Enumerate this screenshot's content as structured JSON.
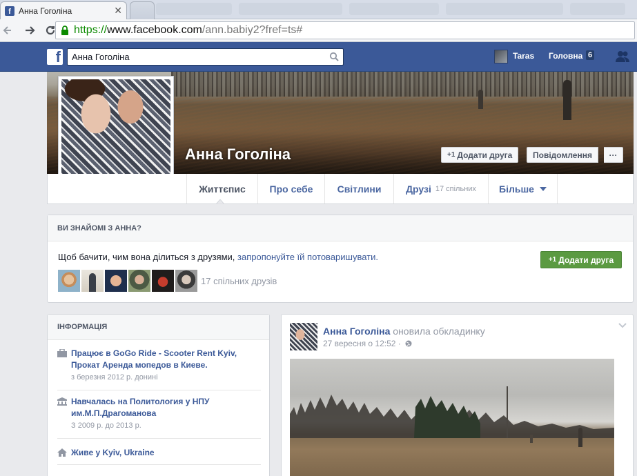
{
  "browser": {
    "active_tab_title": "Анна Гоголіна",
    "url_protocol": "https://",
    "url_host": "www.facebook.com",
    "url_path": "/ann.babiy2?fref=ts#"
  },
  "fb_header": {
    "search_value": "Анна Гоголіна",
    "user_name": "Taras",
    "home_label": "Головна",
    "home_count": "6"
  },
  "profile": {
    "name": "Анна Гоголіна",
    "add_friend_label": "Додати друга",
    "message_label": "Повідомлення",
    "more_label": "···",
    "plus_label": "+1"
  },
  "nav": {
    "items": [
      {
        "label": "Життєпис"
      },
      {
        "label": "Про себе"
      },
      {
        "label": "Світлини"
      },
      {
        "label": "Друзі",
        "count": "17 спільних"
      },
      {
        "label": "Більше"
      }
    ]
  },
  "know_box": {
    "header": "ВИ ЗНАЙОМІ З АННА?",
    "message_prefix": "Щоб бачити, чим вона ділиться з друзями, ",
    "message_link": "запропонуйте їй потоваришувати.",
    "add_friend_label": "Додати друга",
    "mutual_friends": "17 спільних друзів"
  },
  "info": {
    "header": "ІНФОРМАЦІЯ",
    "items": [
      {
        "title": "Працює в GoGo Ride - Scooter Rent Kyiv, Прокат Аренда мопедов в Киеве.",
        "sub": "з березня 2012 р. донині",
        "icon": "briefcase-icon"
      },
      {
        "title": "Навчалась на Политология у НПУ им.М.П.Драгоманова",
        "sub": "З 2009 р. до 2013 р.",
        "icon": "school-icon"
      },
      {
        "title": "Живе у Kyiv, Ukraine",
        "sub": "",
        "icon": "home-icon"
      }
    ]
  },
  "post": {
    "author": "Анна Гоголіна",
    "action": " оновила обкладинку",
    "timestamp": "27 вересня о 12:52 ·"
  },
  "colors": {
    "fb_blue": "#3b5998",
    "green_button": "#5b9a41",
    "link": "#3b5998"
  }
}
